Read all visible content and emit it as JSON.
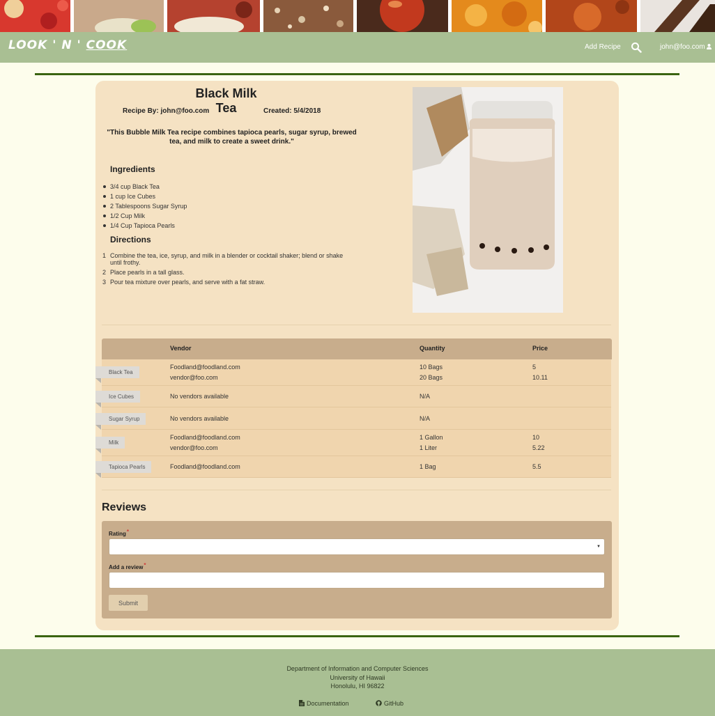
{
  "nav": {
    "brand_left": "LOOK ' N ' ",
    "brand_right": "COOK",
    "add_recipe": "Add Recipe",
    "search_icon": "search-icon",
    "user_email": "john@foo.com"
  },
  "recipe": {
    "title": "Black Milk Tea",
    "recipe_by": "Recipe By: john@foo.com",
    "created": "Created: 5/4/2018",
    "description": "\"This Bubble Milk Tea recipe combines tapioca pearls, sugar syrup, brewed tea, and milk to create a sweet drink.\"",
    "ingredients_heading": "Ingredients",
    "ingredients": [
      "3/4 cup Black Tea",
      "1 cup Ice Cubes",
      "2 Tablespoons Sugar Syrup",
      "1/2 Cup Milk",
      "1/4 Cup Tapioca Pearls"
    ],
    "directions_heading": "Directions",
    "directions": [
      {
        "num": "1",
        "text": "Combine the tea, ice, syrup, and milk in a blender or cocktail shaker; blend or shake until frothy."
      },
      {
        "num": "2",
        "text": "Place pearls in a tall glass."
      },
      {
        "num": "3",
        "text": "Pour tea mixture over pearls, and serve with a fat straw."
      }
    ]
  },
  "vendors": {
    "headers": {
      "vendor": "Vendor",
      "quantity": "Quantity",
      "price": "Price"
    },
    "rows": [
      {
        "ingredient": "Black Tea",
        "vendors": [
          "Foodland@foodland.com",
          "vendor@foo.com"
        ],
        "quantities": [
          "10 Bags",
          "20 Bags"
        ],
        "prices": [
          "5",
          "10.11"
        ]
      },
      {
        "ingredient": "Ice Cubes",
        "vendors": [
          "No vendors available"
        ],
        "quantities": [
          "N/A"
        ],
        "prices": [
          ""
        ]
      },
      {
        "ingredient": "Sugar Syrup",
        "vendors": [
          "No vendors available"
        ],
        "quantities": [
          "N/A"
        ],
        "prices": [
          ""
        ]
      },
      {
        "ingredient": "Milk",
        "vendors": [
          "Foodland@foodland.com",
          "vendor@foo.com"
        ],
        "quantities": [
          "1 Gallon",
          "1 Liter"
        ],
        "prices": [
          "10",
          "5.22"
        ]
      },
      {
        "ingredient": "Tapioca Pearls",
        "vendors": [
          "Foodland@foodland.com"
        ],
        "quantities": [
          "1 Bag"
        ],
        "prices": [
          "5.5"
        ]
      }
    ]
  },
  "reviews": {
    "heading": "Reviews",
    "rating_label": "Rating",
    "review_label": "Add a review",
    "required_mark": "*",
    "submit_label": "Submit"
  },
  "footer": {
    "line1": "Department of Information and Computer Sciences",
    "line2": "University of Hawaii",
    "line3": "Honolulu, HI 96822",
    "docs": "Documentation",
    "github": "GitHub"
  },
  "colors": {
    "nav_bg": "#a9bf93",
    "accent_line": "#3a6410",
    "card_bg": "#f5e2c3",
    "table_header": "#c8ad8c",
    "row_bg": "#f0d5ae"
  }
}
